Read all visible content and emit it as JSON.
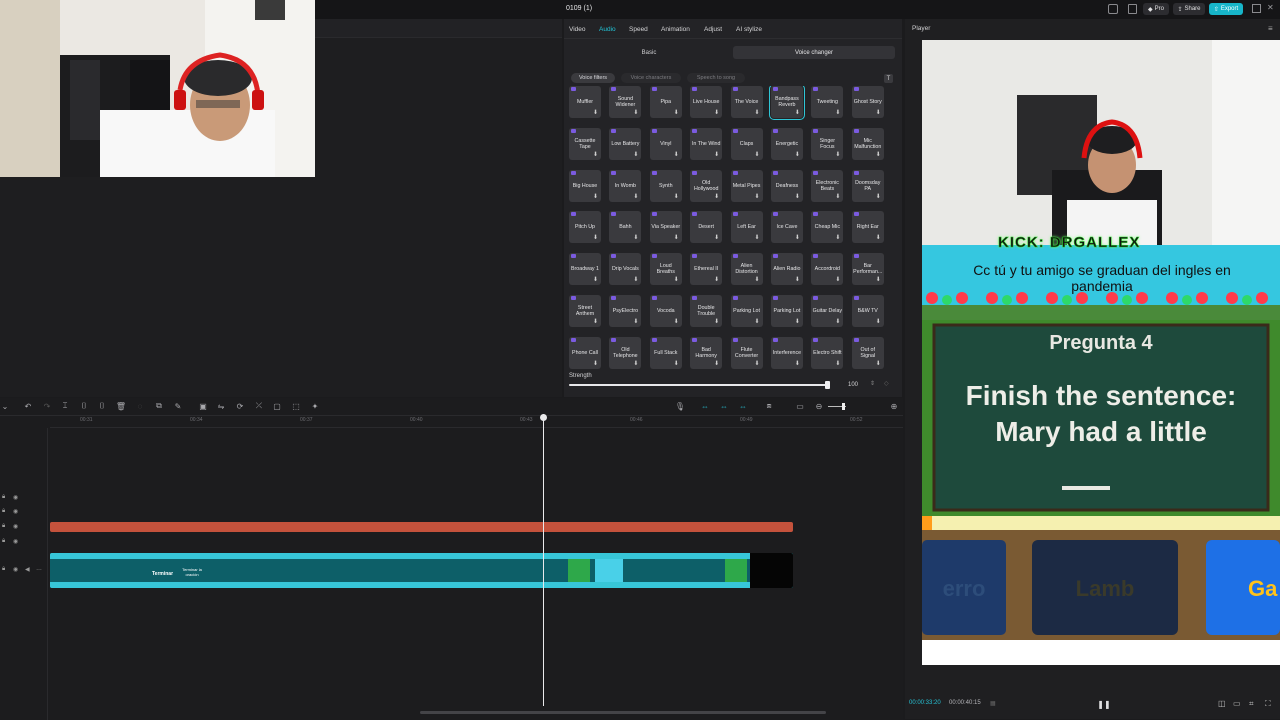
{
  "project": {
    "title": "0109 (1)"
  },
  "topbar": {
    "pro_label": "Pro",
    "share_label": "Share",
    "export_label": "Export"
  },
  "edit_panel": {
    "tabs": [
      {
        "label": "Video",
        "active": false
      },
      {
        "label": "Audio",
        "active": true
      },
      {
        "label": "Speed",
        "active": false
      },
      {
        "label": "Animation",
        "active": false
      },
      {
        "label": "Adjust",
        "active": false
      },
      {
        "label": "AI stylize",
        "active": false
      }
    ],
    "subtabs": {
      "basic": "Basic",
      "voice_changer": "Voice changer"
    },
    "filter_pills": [
      "Voice filters",
      "Voice characters",
      "Speech to song"
    ],
    "effects": [
      "Muffler",
      "Sound Widener",
      "Pipa",
      "Live House",
      "The Voice",
      "Bandpass Reverb",
      "Tweeting",
      "Ghost Story",
      "Cassette Tape",
      "Low Battery",
      "Vinyl",
      "In The Wind",
      "Claps",
      "Energetic",
      "Singer Focus",
      "Mic Malfunction",
      "Big House",
      "In Womb",
      "Synth",
      "Old Hollywood",
      "Metal Pipes",
      "Deafness",
      "Electronic Beats",
      "Doomsday PA",
      "Pitch Up",
      "Bahh",
      "Via Speaker",
      "Desert",
      "Left Ear",
      "Ice Cave",
      "Cheap Mic",
      "Right Ear",
      "Broadway 1",
      "Drip Vocals",
      "Loud Breaths",
      "Ethereal II",
      "Alien Distortion",
      "Alien Radio",
      "Accordroid",
      "Bar Performan...",
      "Street Anthem",
      "PsyElectro",
      "Vocoda",
      "Double Trouble",
      "Parking Lot",
      "Parking Lot",
      "Guitar Delay",
      "B&W TV",
      "Phone Call",
      "Old Telephone",
      "Full Stack",
      "Bad Harmony",
      "Flute Converter",
      "Interference",
      "Electro Shift",
      "Out of Signal"
    ],
    "selected_effect": "Bandpass Reverb",
    "strength": {
      "label": "Strength",
      "value": "100",
      "level": 1.0
    }
  },
  "player": {
    "label": "Player",
    "video": {
      "banner": "KICK: DRGALLEX",
      "caption": "Cc tú y tu amigo se graduan del ingles en pandemia",
      "question_title": "Pregunta 4",
      "question_text": "Finish the sentence: Mary had a little",
      "blank": "____",
      "answers": [
        "erro",
        "Lamb",
        "Ga"
      ]
    },
    "time_current": "00:00:33:20",
    "time_total": "00:00:40:15"
  },
  "timeline": {
    "ruler_ticks": [
      "00:31",
      "00:34",
      "00:37",
      "00:40",
      "00:43",
      "00:46",
      "00:49",
      "00:52"
    ],
    "clip_labels": [
      "Terminar",
      "Terminar la oración"
    ]
  },
  "colors": {
    "accent": "#22c4d6",
    "audio_clip": "#c4523c",
    "video_clip": "#0b7c8a",
    "export": "#17b5c9"
  }
}
